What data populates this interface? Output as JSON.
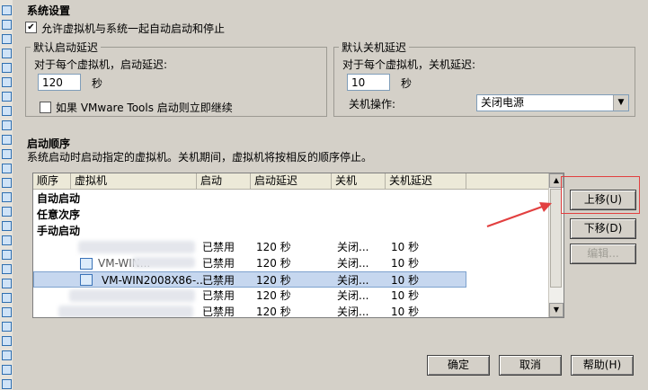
{
  "system_settings": {
    "title": "系统设置",
    "allow_autostart_checked": true,
    "allow_autostart_label": "允许虚拟机与系统一起自动启动和停止"
  },
  "default_start_delay": {
    "legend": "默认启动延迟",
    "label": "对于每个虚拟机，启动延迟:",
    "value": "120",
    "unit": "秒",
    "vmware_tools_checked": false,
    "vmware_tools_label": "如果 VMware Tools 启动则立即继续"
  },
  "default_shutdown_delay": {
    "legend": "默认关机延迟",
    "label": "对于每个虚拟机，关机延迟:",
    "value": "10",
    "unit": "秒",
    "action_label": "关机操作:",
    "action_value": "关闭电源"
  },
  "startup_order": {
    "title": "启动顺序",
    "description": "系统启动时启动指定的虚拟机。关机期间，虚拟机将按相反的顺序停止。",
    "columns": [
      "顺序",
      "虚拟机",
      "启动",
      "启动延迟",
      "关机",
      "关机延迟"
    ],
    "groups": [
      "自动启动",
      "任意次序",
      "手动启动"
    ],
    "rows": [
      {
        "vm": "",
        "start": "已禁用",
        "start_delay": "120 秒",
        "shutdown": "关闭...",
        "shutdown_delay": "10 秒"
      },
      {
        "vm": "VM-WIN...",
        "start": "已禁用",
        "start_delay": "120 秒",
        "shutdown": "关闭...",
        "shutdown_delay": "10 秒"
      },
      {
        "vm": "VM-WIN2008X86-...",
        "start": "已禁用",
        "start_delay": "120 秒",
        "shutdown": "关闭...",
        "shutdown_delay": "10 秒"
      },
      {
        "vm": "",
        "start": "已禁用",
        "start_delay": "120 秒",
        "shutdown": "关闭...",
        "shutdown_delay": "10 秒"
      },
      {
        "vm": "",
        "start": "已禁用",
        "start_delay": "120 秒",
        "shutdown": "关闭...",
        "shutdown_delay": "10 秒"
      }
    ]
  },
  "side_buttons": {
    "move_up": "上移(U)",
    "move_down": "下移(D)",
    "edit": "编辑..."
  },
  "footer": {
    "ok": "确定",
    "cancel": "取消",
    "help": "帮助(H)"
  },
  "colors": {
    "dialog_bg": "#d4d0c8",
    "selection": "#c6d7ef",
    "annotation": "#e24040"
  }
}
